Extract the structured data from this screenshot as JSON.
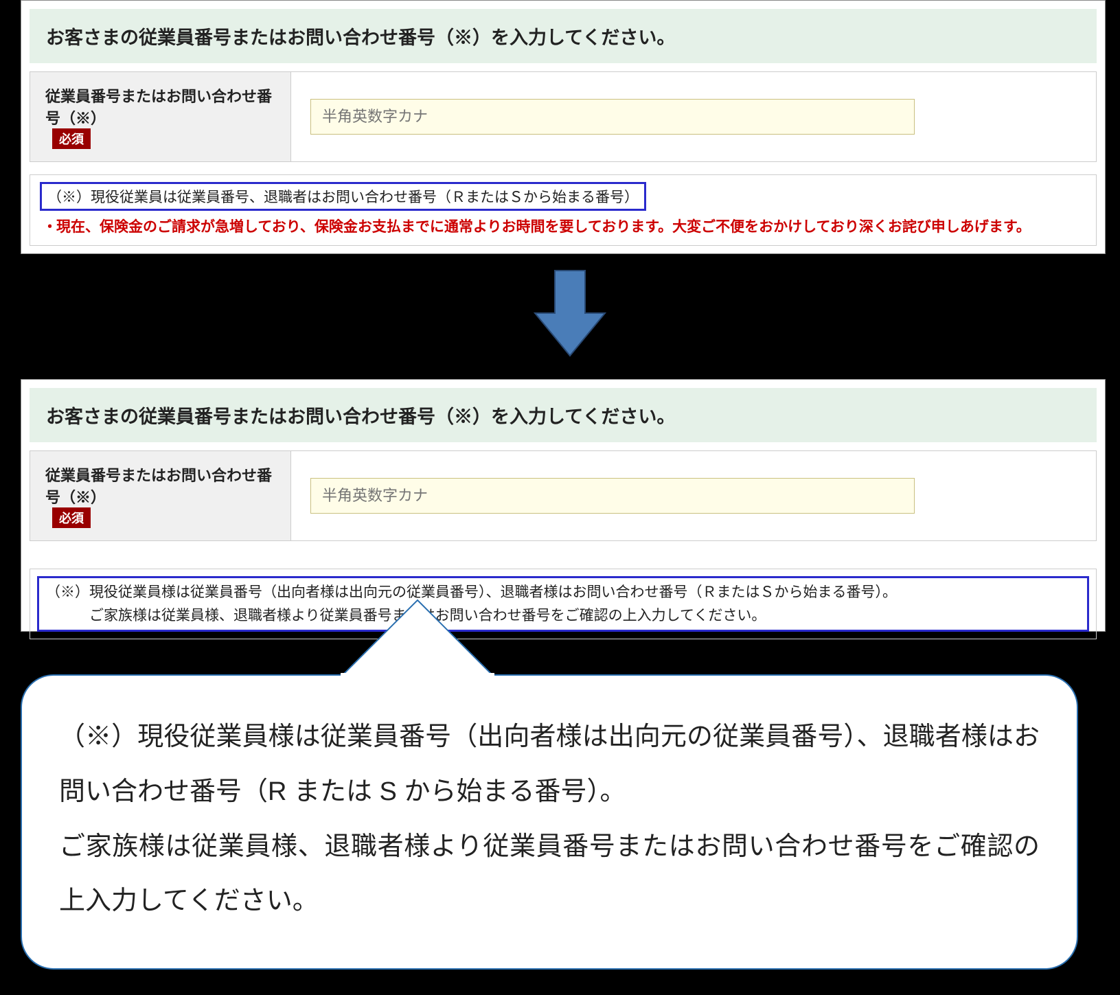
{
  "topPanel": {
    "headerTitle": "お客さまの従業員番号またはお問い合わせ番号（※）を入力してください。",
    "formLabel": "従業員番号またはお問い合わせ番号（※）",
    "requiredBadge": "必須",
    "inputPlaceholder": "半角英数字カナ",
    "noteHighlighted": "（※）現役従業員は従業員番号、退職者はお問い合わせ番号（ＲまたはＳから始まる番号）",
    "noteWarning": "現在、保険金のご請求が急増しており、保険金お支払までに通常よりお時間を要しております。大変ご不便をおかけしており深くお詫び申しあげます。"
  },
  "bottomPanel": {
    "headerTitle": "お客さまの従業員番号またはお問い合わせ番号（※）を入力してください。",
    "formLabel": "従業員番号またはお問い合わせ番号（※）",
    "requiredBadge": "必須",
    "inputPlaceholder": "半角英数字カナ",
    "note2Line1": "（※）現役従業員様は従業員番号（出向者様は出向元の従業員番号）、退職者様はお問い合わせ番号（ＲまたはＳから始まる番号）。",
    "note2Line2": "　　　ご家族様は従業員様、退職者様より従業員番号またはお問い合わせ番号をご確認の上入力してください。"
  },
  "callout": {
    "line1": "（※）現役従業員様は従業員番号（出向者様は出向元の従業員番号）、退職者様はお問い合わせ番号（R または S から始まる番号）。",
    "line2": "ご家族様は従業員様、退職者様より従業員番号またはお問い合わせ番号をご確認の上入力してください。"
  }
}
